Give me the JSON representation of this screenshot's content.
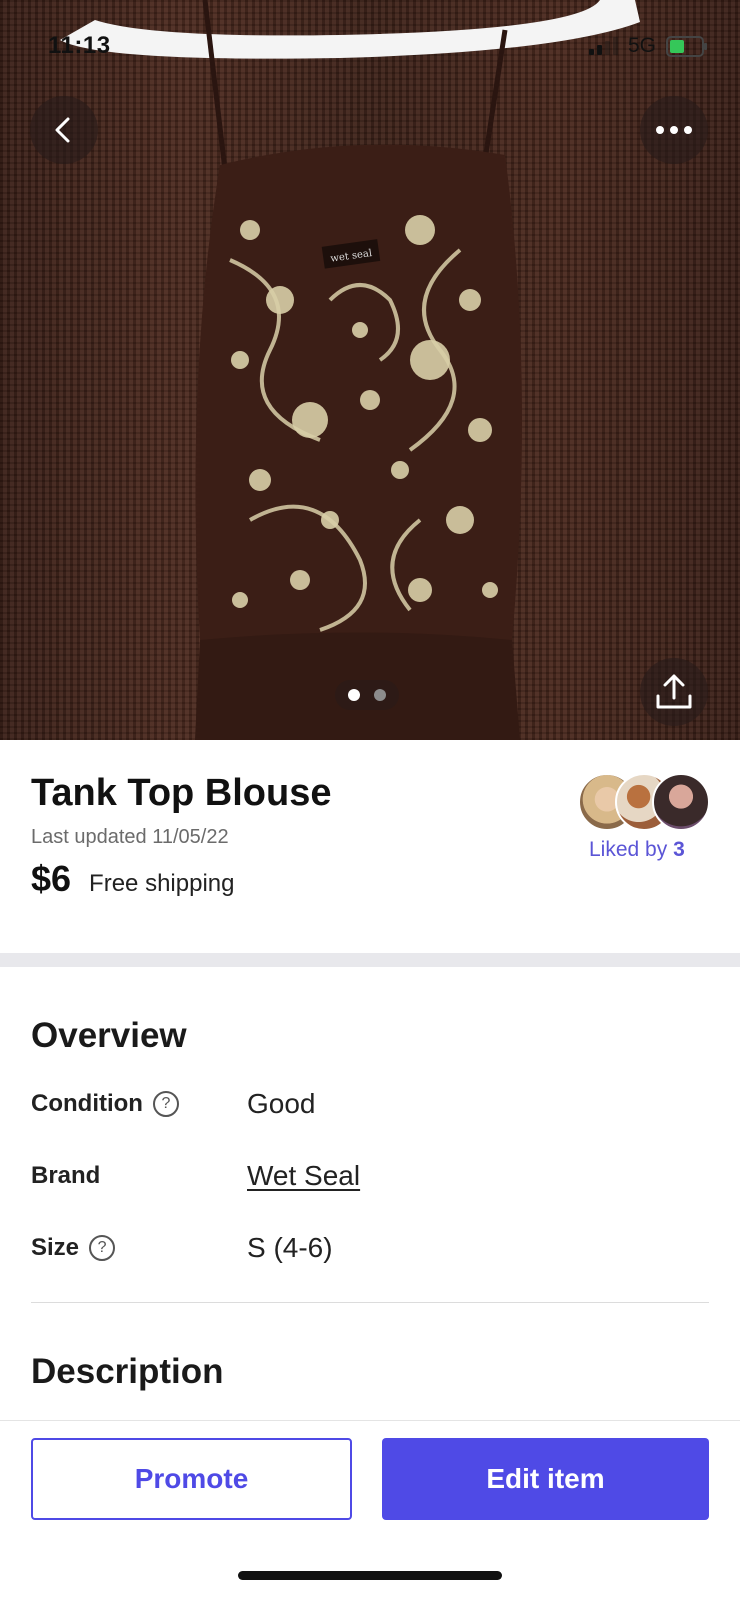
{
  "status_bar": {
    "time": "11:13",
    "network": "5G"
  },
  "photo": {
    "brand_tag": "wet seal",
    "page_count": 2,
    "current_page": 1
  },
  "item": {
    "title": "Tank Top Blouse",
    "last_updated": "Last updated 11/05/22",
    "price": "$6",
    "shipping": "Free shipping"
  },
  "likes": {
    "label": "Liked by",
    "count": "3"
  },
  "overview": {
    "title": "Overview",
    "rows": [
      {
        "label": "Condition",
        "value": "Good"
      },
      {
        "label": "Brand",
        "value": "Wet Seal"
      },
      {
        "label": "Size",
        "value": "S (4-6)"
      }
    ]
  },
  "description": {
    "title": "Description"
  },
  "actions": {
    "promote": "Promote",
    "edit": "Edit item"
  },
  "colors": {
    "accent": "#4f4ae6",
    "blouse_base": "#3b1e16",
    "pattern": "#d9cfa8"
  }
}
